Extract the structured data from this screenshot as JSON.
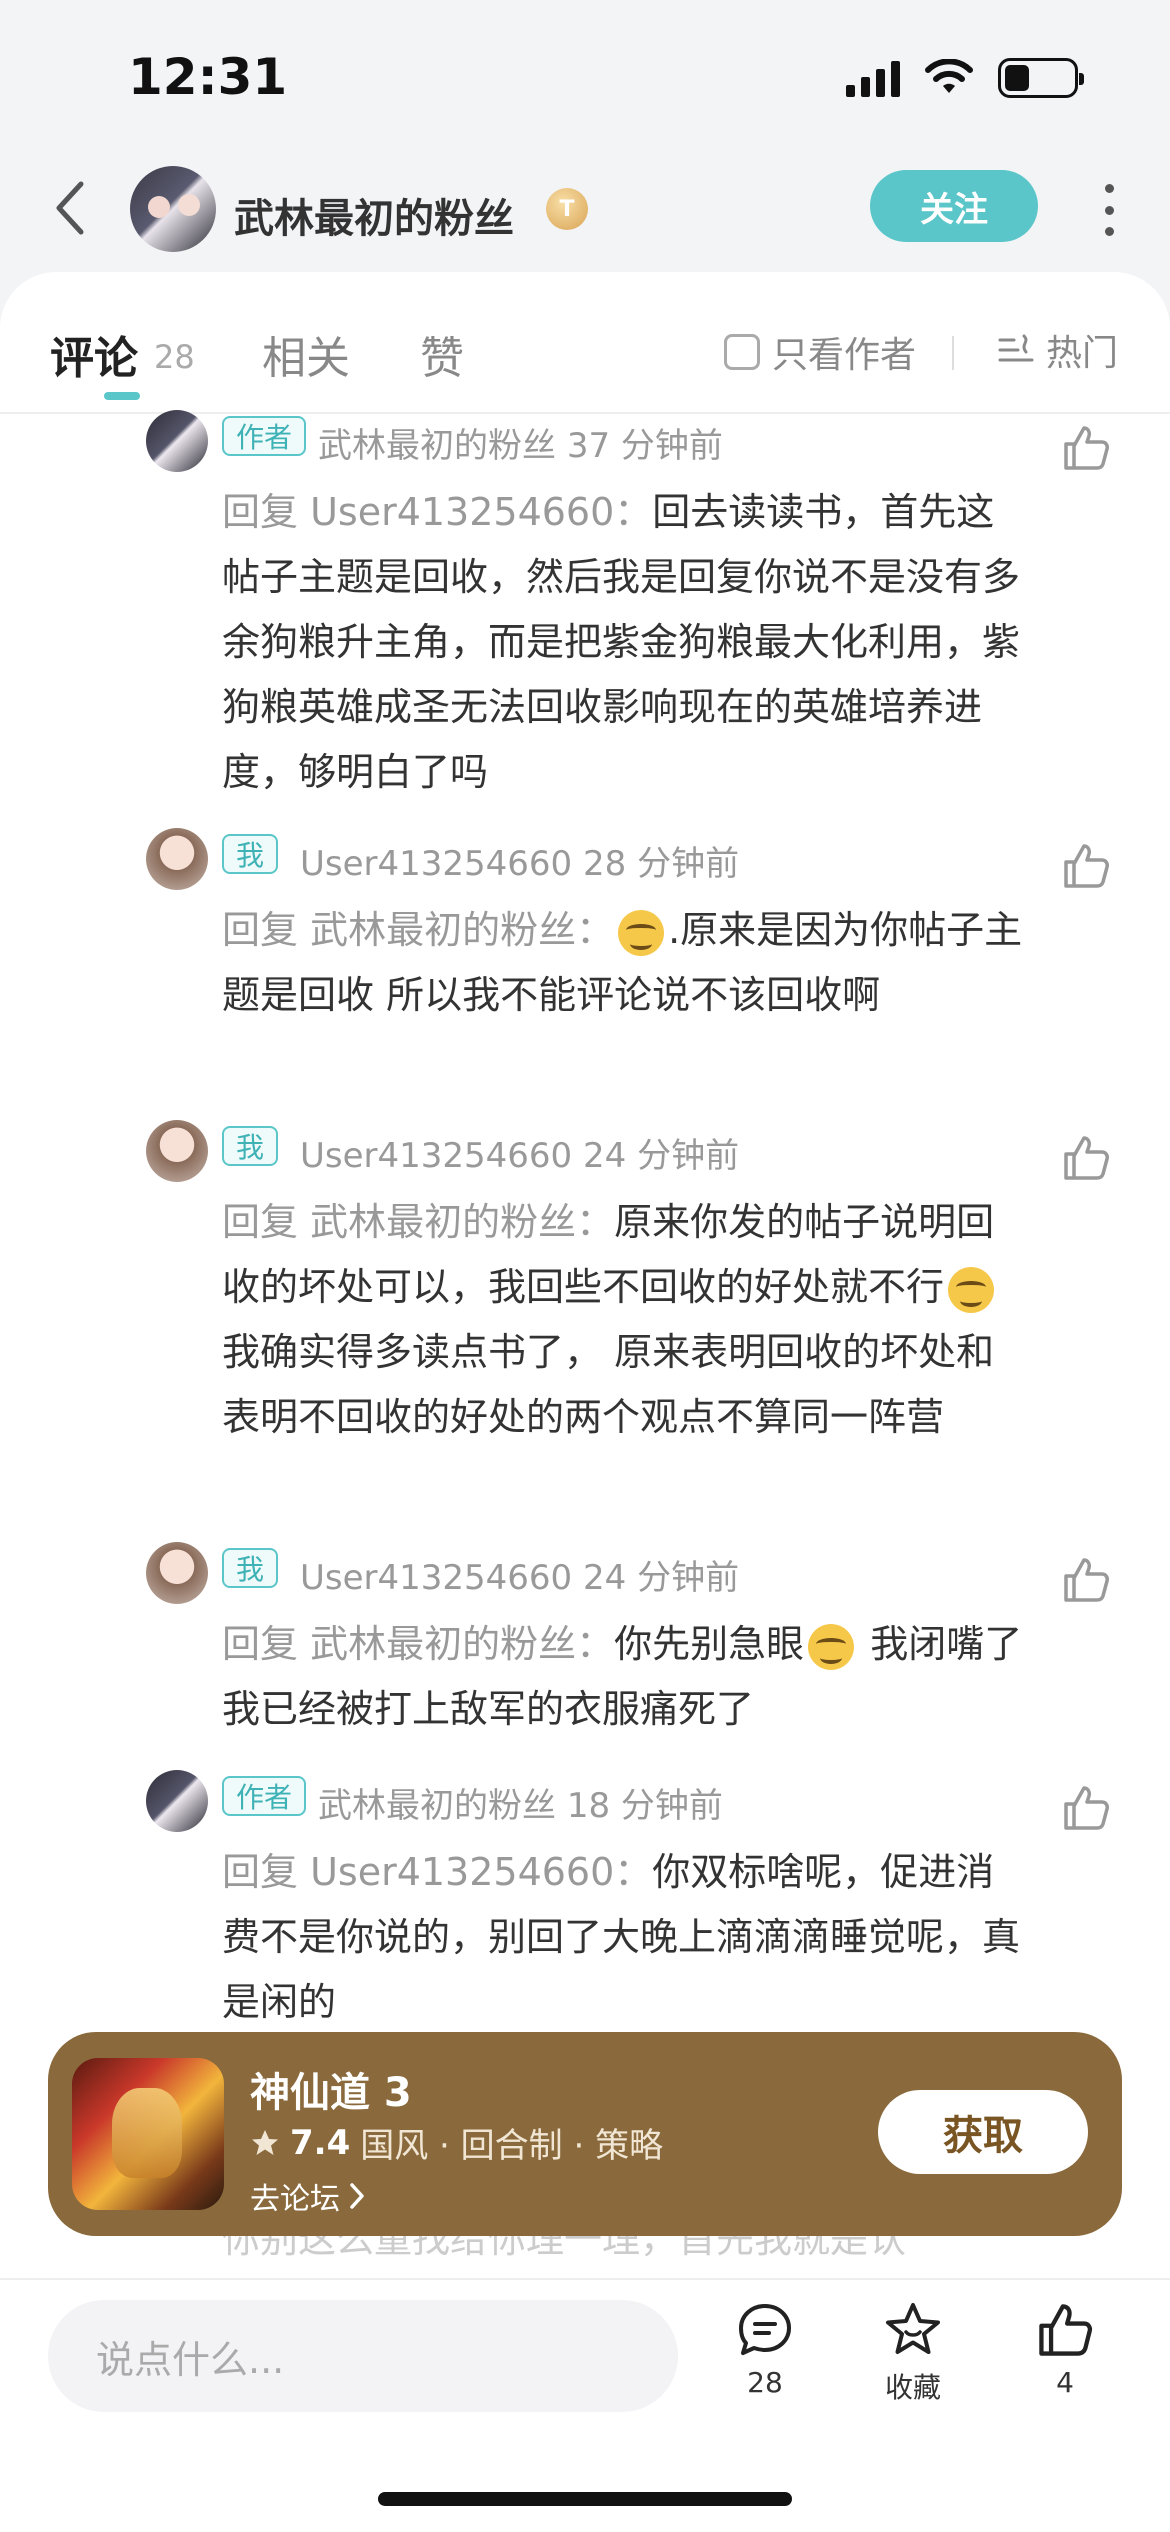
{
  "status_bar": {
    "time": "12:31"
  },
  "header": {
    "user_name": "武林最初的粉丝",
    "name_badge": "T",
    "follow_label": "关注"
  },
  "tabs": {
    "comments_label": "评论",
    "comments_count": "28",
    "related_label": "相关",
    "likes_label": "赞",
    "only_author_label": "只看作者",
    "sort_label": "热门"
  },
  "comments": [
    {
      "tag": "作者",
      "user": "武林最初的粉丝",
      "time": "37 分钟前",
      "prefix": "回复 User413254660：",
      "text": "回去读读书，首先这帖子主题是回收，然后我是回复你说不是没有多余狗粮升主角，而是把紫金狗粮最大化利用，紫狗粮英雄成圣无法回收影响现在的英雄培养进度，够明白了吗"
    },
    {
      "tag": "我",
      "user": "User413254660",
      "time": "28 分钟前",
      "prefix": "回复 武林最初的粉丝：",
      "text": ".原来是因为你帖子主题是回收  所以我不能评论说不该回收啊"
    },
    {
      "tag": "我",
      "user": "User413254660",
      "time": "24 分钟前",
      "prefix": "回复 武林最初的粉丝：",
      "text_a": "原来你发的帖子说明回收的坏处可以，我回些不回收的好处就不行",
      "text_b": " 我确实得多读点书了，  原来表明回收的坏处和表明不回收的好处的两个观点不算同一阵营"
    },
    {
      "tag": "我",
      "user": "User413254660",
      "time": "24 分钟前",
      "prefix": "回复 武林最初的粉丝：",
      "text_a": "你先别急眼",
      "text_b": " 我闭嘴了 我已经被打上敌军的衣服痛死了"
    },
    {
      "tag": "作者",
      "user": "武林最初的粉丝",
      "time": "18 分钟前",
      "prefix": "回复 User413254660：",
      "text": "你双标啥呢，促进消费不是你说的，别回了大晚上滴滴滴睡觉呢，真是闲的"
    }
  ],
  "peek_text": "你别这么童找给你理一理，首先我就是认",
  "game_banner": {
    "title": "神仙道 3",
    "rating": "7.4",
    "tags": "国风 · 回合制 · 策略",
    "forum_link": "去论坛",
    "get_label": "获取"
  },
  "bottom_bar": {
    "input_placeholder": "说点什么...",
    "comment_count": "28",
    "favorite_label": "收藏",
    "like_count": "4"
  },
  "colors": {
    "accent": "#5ac6c9",
    "banner": "#8a6a3c"
  }
}
